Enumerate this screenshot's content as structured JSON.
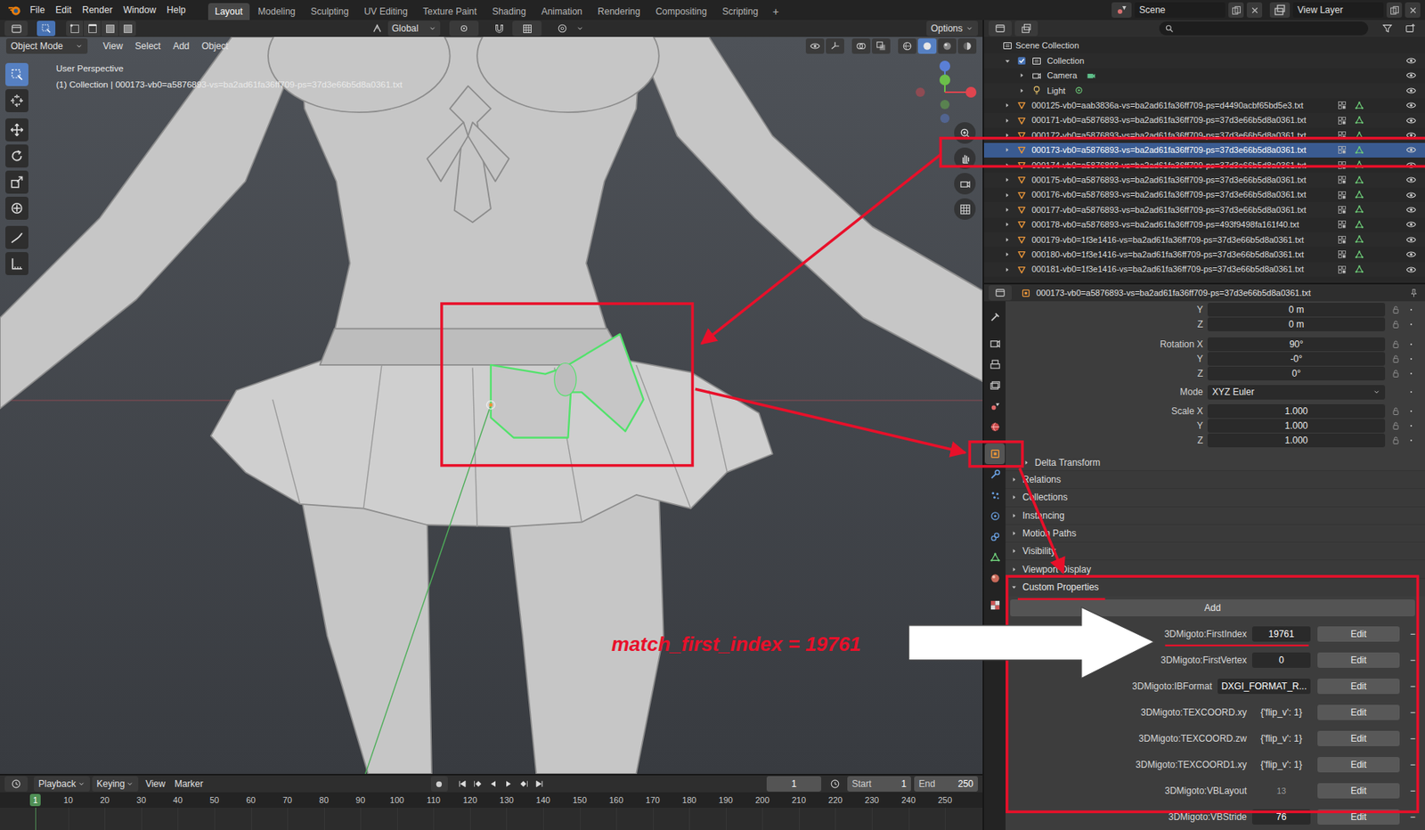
{
  "menu": [
    "File",
    "Edit",
    "Render",
    "Window",
    "Help"
  ],
  "workspaces": [
    {
      "label": "Layout",
      "selected": true
    },
    {
      "label": "Modeling",
      "selected": false
    },
    {
      "label": "Sculpting",
      "selected": false
    },
    {
      "label": "UV Editing",
      "selected": false
    },
    {
      "label": "Texture Paint",
      "selected": false
    },
    {
      "label": "Shading",
      "selected": false
    },
    {
      "label": "Animation",
      "selected": false
    },
    {
      "label": "Rendering",
      "selected": false
    },
    {
      "label": "Compositing",
      "selected": false
    },
    {
      "label": "Scripting",
      "selected": false
    }
  ],
  "add_workspace": "+",
  "scene": "Scene",
  "view_layer": "View Layer",
  "viewport": {
    "mode": "Object Mode",
    "menus": [
      "View",
      "Select",
      "Add",
      "Object"
    ],
    "orientation": "Global",
    "options": "Options",
    "title": "User Perspective",
    "info": "(1) Collection | 000173-vb0=a5876893-vs=ba2ad61fa36ff709-ps=37d3e66b5d8a0361.txt",
    "tools": [
      {
        "selected": true
      },
      {
        "selected": false
      },
      {
        "selected": false
      },
      {
        "selected": false
      },
      {
        "selected": false
      },
      {
        "selected": false
      },
      {
        "selected": false
      },
      {
        "selected": false
      }
    ]
  },
  "outliner": {
    "scene_collection": "Scene Collection",
    "collection": {
      "name": "Collection",
      "checked": true,
      "expanded": true,
      "visible": true
    },
    "rows": [
      {
        "kind": "camera",
        "name": "Camera",
        "selected": false,
        "visible": true
      },
      {
        "kind": "light",
        "name": "Light",
        "selected": false,
        "visible": true
      },
      {
        "kind": "mesh",
        "name": "000125-vb0=aab3836a-vs=ba2ad61fa36ff709-ps=d4490acbf65bd5e3.txt",
        "selected": false,
        "visible": true
      },
      {
        "kind": "mesh",
        "name": "000171-vb0=a5876893-vs=ba2ad61fa36ff709-ps=37d3e66b5d8a0361.txt",
        "selected": false,
        "visible": true
      },
      {
        "kind": "mesh",
        "name": "000172-vb0=a5876893-vs=ba2ad61fa36ff709-ps=37d3e66b5d8a0361.txt",
        "selected": false,
        "visible": true
      },
      {
        "kind": "mesh",
        "name": "000173-vb0=a5876893-vs=ba2ad61fa36ff709-ps=37d3e66b5d8a0361.txt",
        "selected": true,
        "visible": true
      },
      {
        "kind": "mesh",
        "name": "000174-vb0=a5876893-vs=ba2ad61fa36ff709-ps=37d3e66b5d8a0361.txt",
        "selected": false,
        "visible": true
      },
      {
        "kind": "mesh",
        "name": "000175-vb0=a5876893-vs=ba2ad61fa36ff709-ps=37d3e66b5d8a0361.txt",
        "selected": false,
        "visible": true
      },
      {
        "kind": "mesh",
        "name": "000176-vb0=a5876893-vs=ba2ad61fa36ff709-ps=37d3e66b5d8a0361.txt",
        "selected": false,
        "visible": true
      },
      {
        "kind": "mesh",
        "name": "000177-vb0=a5876893-vs=ba2ad61fa36ff709-ps=37d3e66b5d8a0361.txt",
        "selected": false,
        "visible": true
      },
      {
        "kind": "mesh",
        "name": "000178-vb0=a5876893-vs=ba2ad61fa36ff709-ps=493f9498fa161f40.txt",
        "selected": false,
        "visible": true
      },
      {
        "kind": "mesh",
        "name": "000179-vb0=1f3e1416-vs=ba2ad61fa36ff709-ps=37d3e66b5d8a0361.txt",
        "selected": false,
        "visible": true
      },
      {
        "kind": "mesh",
        "name": "000180-vb0=1f3e1416-vs=ba2ad61fa36ff709-ps=37d3e66b5d8a0361.txt",
        "selected": false,
        "visible": true
      },
      {
        "kind": "mesh",
        "name": "000181-vb0=1f3e1416-vs=ba2ad61fa36ff709-ps=37d3e66b5d8a0361.txt",
        "selected": false,
        "visible": true
      }
    ]
  },
  "properties": {
    "object": "000173-vb0=a5876893-vs=ba2ad61fa36ff709-ps=37d3e66b5d8a0361.txt",
    "tabs": [
      {
        "selected": false
      },
      {
        "selected": false
      },
      {
        "selected": false
      },
      {
        "selected": false
      },
      {
        "selected": false
      },
      {
        "selected": false
      },
      {
        "selected": true
      },
      {
        "selected": false
      },
      {
        "selected": false
      },
      {
        "selected": false
      },
      {
        "selected": false
      },
      {
        "selected": false
      },
      {
        "selected": false
      },
      {
        "selected": false
      }
    ],
    "transform": [
      [
        {
          "label": "Y",
          "value": "0 m",
          "kind": "number"
        },
        {
          "label": "Z",
          "value": "0 m",
          "kind": "number"
        }
      ],
      [
        {
          "label": "Rotation X",
          "value": "90°",
          "kind": "number"
        },
        {
          "label": "Y",
          "value": "-0°",
          "kind": "number"
        },
        {
          "label": "Z",
          "value": "0°",
          "kind": "number"
        }
      ],
      [
        {
          "label": "Mode",
          "value": "XYZ Euler",
          "kind": "dropdown"
        }
      ],
      [
        {
          "label": "Scale X",
          "value": "1.000",
          "kind": "number"
        },
        {
          "label": "Y",
          "value": "1.000",
          "kind": "number"
        },
        {
          "label": "Z",
          "value": "1.000",
          "kind": "number"
        }
      ]
    ],
    "panels": [
      {
        "label": "Delta Transform",
        "kind": "subpanel",
        "expanded": false
      },
      {
        "label": "Relations",
        "kind": "panel",
        "expanded": false
      },
      {
        "label": "Collections",
        "kind": "panel",
        "expanded": false
      },
      {
        "label": "Instancing",
        "kind": "panel",
        "expanded": false
      },
      {
        "label": "Motion Paths",
        "kind": "panel",
        "expanded": false
      },
      {
        "label": "Visibility",
        "kind": "panel",
        "expanded": false
      },
      {
        "label": "Viewport Display",
        "kind": "panel",
        "expanded": false
      }
    ],
    "custom": {
      "label": "Custom Properties",
      "expanded": true,
      "add": "Add",
      "items": [
        {
          "name": "3DMigoto:FirstIndex",
          "value": "19761",
          "kind": "field",
          "button": "Edit",
          "remove": "−"
        },
        {
          "name": "3DMigoto:FirstVertex",
          "value": "0",
          "kind": "field",
          "button": "Edit",
          "remove": "−"
        },
        {
          "name": "3DMigoto:IBFormat",
          "value": "DXGI_FORMAT_R...",
          "kind": "field",
          "button": "Edit",
          "remove": "−"
        },
        {
          "name": "3DMigoto:TEXCOORD.xy",
          "value": "{'flip_v': 1}",
          "kind": "text",
          "button": "Edit",
          "remove": "−"
        },
        {
          "name": "3DMigoto:TEXCOORD.zw",
          "value": "{'flip_v': 1}",
          "kind": "text",
          "button": "Edit",
          "remove": "−"
        },
        {
          "name": "3DMigoto:TEXCOORD1.xy",
          "value": "{'flip_v': 1}",
          "kind": "text",
          "button": "Edit",
          "remove": "−"
        },
        {
          "name": "3DMigoto:VBLayout",
          "value": "13",
          "kind": "group",
          "button": "Edit",
          "remove": "−"
        },
        {
          "name": "3DMigoto:VBStride",
          "value": "76",
          "kind": "field",
          "button": "Edit",
          "remove": "−"
        }
      ]
    }
  },
  "timeline": {
    "menus": [
      {
        "label": "Playback",
        "kind": "dropdown"
      },
      {
        "label": "Keying",
        "kind": "dropdown"
      },
      {
        "label": "View",
        "kind": "menu"
      },
      {
        "label": "Marker",
        "kind": "menu"
      }
    ],
    "frame": "1",
    "start_label": "Start",
    "start": "1",
    "end_label": "End",
    "end": "250",
    "ticks": [
      {
        "label": "1",
        "selected": true
      },
      {
        "label": "10",
        "selected": false
      },
      {
        "label": "20",
        "selected": false
      },
      {
        "label": "30",
        "selected": false
      },
      {
        "label": "40",
        "selected": false
      },
      {
        "label": "50",
        "selected": false
      },
      {
        "label": "60",
        "selected": false
      },
      {
        "label": "70",
        "selected": false
      },
      {
        "label": "80",
        "selected": false
      },
      {
        "label": "90",
        "selected": false
      },
      {
        "label": "100",
        "selected": false
      },
      {
        "label": "110",
        "selected": false
      },
      {
        "label": "120",
        "selected": false
      },
      {
        "label": "130",
        "selected": false
      },
      {
        "label": "140",
        "selected": false
      },
      {
        "label": "150",
        "selected": false
      },
      {
        "label": "160",
        "selected": false
      },
      {
        "label": "170",
        "selected": false
      },
      {
        "label": "180",
        "selected": false
      },
      {
        "label": "190",
        "selected": false
      },
      {
        "label": "200",
        "selected": false
      },
      {
        "label": "210",
        "selected": false
      },
      {
        "label": "220",
        "selected": false
      },
      {
        "label": "230",
        "selected": false
      },
      {
        "label": "240",
        "selected": false
      },
      {
        "label": "250",
        "selected": false
      }
    ]
  },
  "annotation": "match_first_index = 19761"
}
